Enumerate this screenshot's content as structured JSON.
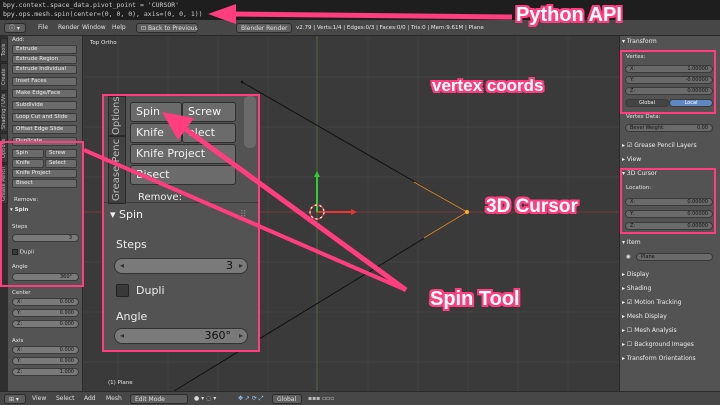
{
  "console": {
    "line1": "bpy.context.space_data.pivot_point = 'CURSOR'",
    "line2": "bpy.ops.mesh.spin(center=(0, 0, 0), axis=(0, 0, 1))"
  },
  "header": {
    "menus": [
      "File",
      "Render",
      "Window",
      "Help"
    ],
    "back_button": "Back to Previous",
    "render_engine": "Blender Render",
    "stats": "v2.79 | Verts:1/4 | Edges:0/3 | Faces:0/0 | Tris:0 | Mem:9.61M | Plane"
  },
  "tabs": [
    "Tools",
    "Create",
    "Shading / UVs",
    "Options",
    "Grease Pencil"
  ],
  "toolshelf": {
    "add_label": "Add:",
    "buttons": [
      "Extrude",
      "Extrude Region",
      "Extrude Individual",
      "Inset Faces",
      "Make Edge/Face",
      "Subdivide",
      "Loop Cut and Slide",
      "Offset Edge Slide",
      "Duplicate"
    ],
    "spin": "Spin",
    "screw": "Screw",
    "knife": "Knife",
    "select": "Select",
    "knife_project": "Knife Project",
    "bisect": "Bisect",
    "remove": "Remove:"
  },
  "operator": {
    "title": "Spin",
    "steps_label": "Steps",
    "steps_value": "3",
    "dupli_label": "Dupli",
    "angle_label": "Angle",
    "angle_value": "360°",
    "center_label": "Center",
    "center": [
      {
        "k": "X:",
        "v": "0.000"
      },
      {
        "k": "Y:",
        "v": "0.000"
      },
      {
        "k": "Z:",
        "v": "0.000"
      }
    ],
    "axis_label": "Axis",
    "axis": [
      {
        "k": "X:",
        "v": "0.000"
      },
      {
        "k": "Y:",
        "v": "0.000"
      },
      {
        "k": "Z:",
        "v": "1.000"
      }
    ]
  },
  "zoom": {
    "tab_label": "Options",
    "tab2_label": "Grease Penc",
    "spin": "Spin",
    "screw": "Screw",
    "knife": "Knife",
    "select_partial": "elect",
    "knife_project": "Knife Project",
    "bisect": "Bisect",
    "remove": "Remove:",
    "panel_title": "Spin",
    "steps_label": "Steps",
    "steps_value": "3",
    "dupli_label": "Dupli",
    "angle_label": "Angle",
    "angle_value": "360°"
  },
  "viewport": {
    "view_name": "Top Ortho",
    "object_label": "(1) Plane"
  },
  "rpanel": {
    "transform": "Transform",
    "vertex_label": "Vertex:",
    "vertex": [
      {
        "k": "X:",
        "v": "1.00000"
      },
      {
        "k": "Y:",
        "v": "-0.00000"
      },
      {
        "k": "Z:",
        "v": "0.00000"
      }
    ],
    "global": "Global",
    "local": "Local",
    "vertex_data": "Vertex Data:",
    "bevel_weight": "Bevel Weight:",
    "bevel_value": "0.00",
    "grease_pencil_layers": "Grease Pencil Layers",
    "view": "View",
    "cursor": "3D Cursor",
    "location": "Location:",
    "cursor_loc": [
      {
        "k": "X:",
        "v": "0.00000"
      },
      {
        "k": "Y:",
        "v": "0.00000"
      },
      {
        "k": "Z:",
        "v": "0.00000"
      }
    ],
    "item": "Item",
    "item_name": "Plane",
    "sections": [
      "Display",
      "Shading",
      "Motion Tracking",
      "Mesh Display",
      "Mesh Analysis",
      "Background Images",
      "Transform Orientations"
    ]
  },
  "bottombar": {
    "menus": [
      "View",
      "Select",
      "Add",
      "Mesh"
    ],
    "mode": "Edit Mode",
    "orientation": "Global"
  },
  "annotations": {
    "python_api": "Python API",
    "vertex_coords": "vertex coords",
    "cursor_3d": "3D Cursor",
    "spin_tool": "Spin Tool"
  },
  "colors": {
    "accent": "#ff3d7f",
    "background": "#3a3a3a",
    "panel": "#535353"
  }
}
